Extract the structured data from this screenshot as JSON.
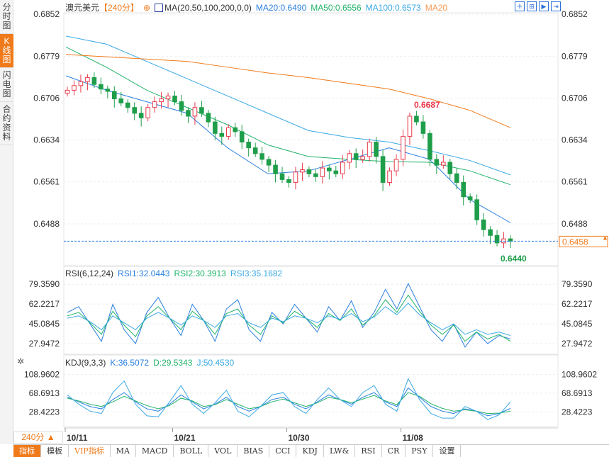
{
  "sidebar": {
    "tabs": [
      "分时图",
      "K线图",
      "闪电图",
      "合约资料"
    ],
    "active": 1
  },
  "header": {
    "symbol": "澳元美元",
    "period": "【240分】",
    "ma_label": "MA(20,50,100,200,0,0)",
    "ma20": "MA20:0.6490",
    "ma50": "MA50:0.6556",
    "ma100": "MA100:0.6573",
    "ma200": "MA20"
  },
  "period_selector": "240分 ▲",
  "colors": {
    "up": "#e8394a",
    "down": "#1e9e4a",
    "ma20": "#2a7fe0",
    "ma50": "#22b36a",
    "ma100": "#3aa9e6",
    "ma200": "#f07a1a"
  },
  "rsi_header": {
    "label": "RSI(6,12,24)",
    "rsi1": "RSI1:32.0443",
    "rsi2": "RSI2:30.3913",
    "rsi3": "RSI3:35.1682"
  },
  "kdj_header": {
    "label": "KDJ(9,3,3)",
    "k": "K:36.5072",
    "d": "D:29.5343",
    "j": "J:50.4530"
  },
  "bottom_tabs": [
    "指标",
    "模板",
    "VIP指标",
    "MA",
    "MACD",
    "BOLL",
    "VOL",
    "BIAS",
    "CCI",
    "KDJ",
    "LW&",
    "RSI",
    "CR",
    "PSY",
    "设置"
  ],
  "chart_data": {
    "type": "candlestick",
    "price_ticks": [
      "0.6852",
      "0.6779",
      "0.6706",
      "0.6634",
      "0.6561",
      "0.6488"
    ],
    "ylim": [
      0.644,
      0.6852
    ],
    "last_price": "0.6458",
    "high_label": "0.6687",
    "low_label": "0.6440",
    "x_ticks": [
      {
        "label": "10/11",
        "i": 0
      },
      {
        "label": "10/21",
        "i": 16
      },
      {
        "label": "10/30",
        "i": 33
      },
      {
        "label": "11/08",
        "i": 50
      }
    ],
    "close": [
      0.672,
      0.6728,
      0.6735,
      0.6742,
      0.673,
      0.6722,
      0.6718,
      0.6705,
      0.6698,
      0.669,
      0.668,
      0.6672,
      0.669,
      0.67,
      0.6705,
      0.671,
      0.67,
      0.6685,
      0.6675,
      0.669,
      0.668,
      0.6665,
      0.6645,
      0.664,
      0.6655,
      0.6648,
      0.663,
      0.662,
      0.661,
      0.66,
      0.659,
      0.6575,
      0.6565,
      0.656,
      0.6578,
      0.6582,
      0.6575,
      0.657,
      0.6585,
      0.658,
      0.6575,
      0.6595,
      0.661,
      0.66,
      0.6605,
      0.663,
      0.6605,
      0.656,
      0.658,
      0.66,
      0.664,
      0.6675,
      0.6665,
      0.6645,
      0.66,
      0.659,
      0.6595,
      0.6575,
      0.656,
      0.6535,
      0.653,
      0.6495,
      0.6478,
      0.6468,
      0.6455,
      0.6462,
      0.6458
    ],
    "ma": [
      {
        "name": "MA20",
        "values": [
          0.6745,
          0.672,
          0.67,
          0.668,
          0.662,
          0.6575,
          0.658,
          0.66,
          0.662,
          0.66,
          0.653,
          0.649
        ]
      },
      {
        "name": "MA50",
        "values": [
          0.6795,
          0.676,
          0.672,
          0.669,
          0.666,
          0.6625,
          0.6605,
          0.66,
          0.6596,
          0.6595,
          0.658,
          0.6556
        ]
      },
      {
        "name": "MA100",
        "values": [
          0.6814,
          0.68,
          0.677,
          0.674,
          0.671,
          0.668,
          0.665,
          0.6638,
          0.663,
          0.6615,
          0.6598,
          0.6573
        ]
      },
      {
        "name": "MA200",
        "values": [
          0.6782,
          0.6778,
          0.6774,
          0.677,
          0.676,
          0.675,
          0.6742,
          0.6732,
          0.6722,
          0.6705,
          0.6685,
          0.6655
        ]
      }
    ],
    "rsi": {
      "ticks": [
        "79.3590",
        "62.2217",
        "45.0845",
        "27.9472"
      ],
      "ylim": [
        20,
        85
      ],
      "rsi1": [
        55,
        60,
        45,
        30,
        62,
        40,
        28,
        55,
        68,
        50,
        35,
        62,
        48,
        30,
        58,
        66,
        40,
        30,
        55,
        45,
        62,
        50,
        38,
        60,
        48,
        65,
        42,
        55,
        75,
        58,
        80,
        60,
        40,
        30,
        45,
        25,
        38,
        28,
        35,
        32
      ],
      "rsi2": [
        52,
        55,
        46,
        36,
        56,
        44,
        34,
        52,
        60,
        50,
        40,
        56,
        48,
        36,
        54,
        58,
        44,
        36,
        52,
        46,
        56,
        50,
        42,
        54,
        48,
        58,
        44,
        52,
        66,
        55,
        70,
        56,
        44,
        36,
        44,
        30,
        38,
        32,
        36,
        30
      ],
      "rsi3": [
        50,
        52,
        47,
        40,
        52,
        46,
        40,
        50,
        55,
        50,
        44,
        52,
        48,
        42,
        52,
        54,
        46,
        42,
        50,
        47,
        52,
        50,
        46,
        52,
        49,
        54,
        47,
        51,
        60,
        53,
        63,
        53,
        46,
        40,
        45,
        36,
        40,
        36,
        38,
        35
      ]
    },
    "kdj": {
      "ticks": [
        "108.9602",
        "68.6913",
        "28.4223"
      ],
      "ylim": [
        0,
        125
      ],
      "k": [
        60,
        50,
        40,
        35,
        55,
        70,
        50,
        35,
        30,
        45,
        65,
        50,
        35,
        45,
        60,
        40,
        30,
        40,
        55,
        60,
        45,
        35,
        50,
        65,
        55,
        45,
        60,
        70,
        50,
        40,
        80,
        60,
        40,
        30,
        25,
        35,
        30,
        20,
        25,
        36
      ],
      "d": [
        58,
        52,
        45,
        40,
        50,
        62,
        52,
        42,
        35,
        42,
        58,
        52,
        40,
        44,
        55,
        45,
        35,
        40,
        50,
        56,
        48,
        40,
        48,
        60,
        55,
        48,
        56,
        64,
        52,
        44,
        70,
        62,
        46,
        36,
        30,
        33,
        30,
        25,
        26,
        30
      ],
      "j": [
        65,
        45,
        30,
        25,
        70,
        95,
        45,
        20,
        18,
        50,
        85,
        45,
        25,
        48,
        75,
        30,
        18,
        40,
        65,
        70,
        40,
        25,
        55,
        80,
        55,
        40,
        70,
        85,
        45,
        30,
        100,
        55,
        25,
        15,
        15,
        40,
        30,
        12,
        22,
        50
      ]
    }
  }
}
